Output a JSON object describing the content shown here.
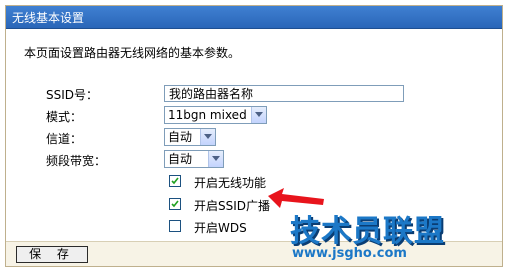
{
  "panel": {
    "title": "无线基本设置"
  },
  "description": "本页面设置路由器无线网络的基本参数。",
  "form": {
    "ssid_label": "SSID号：",
    "ssid_value": "我的路由器名称",
    "mode_label": "模式：",
    "mode_value": "11bgn mixed",
    "channel_label": "信道：",
    "channel_value": "自动",
    "bandwidth_label": "频段带宽：",
    "bandwidth_value": "自动"
  },
  "checkboxes": [
    {
      "label": "开启无线功能",
      "checked": true
    },
    {
      "label": "开启SSID广播",
      "checked": true
    },
    {
      "label": "开启WDS",
      "checked": false
    }
  ],
  "footer": {
    "save_label": "保 存"
  },
  "annotation": {
    "arrow_color": "#e8141c"
  },
  "watermark": {
    "logo_text": "技术员联盟",
    "url": "www.jsgho.com",
    "color": "#1c78c7"
  },
  "icons": {
    "dropdown": "chevron-down-icon",
    "check": "checkmark-icon",
    "arrow": "arrow-left-icon"
  }
}
